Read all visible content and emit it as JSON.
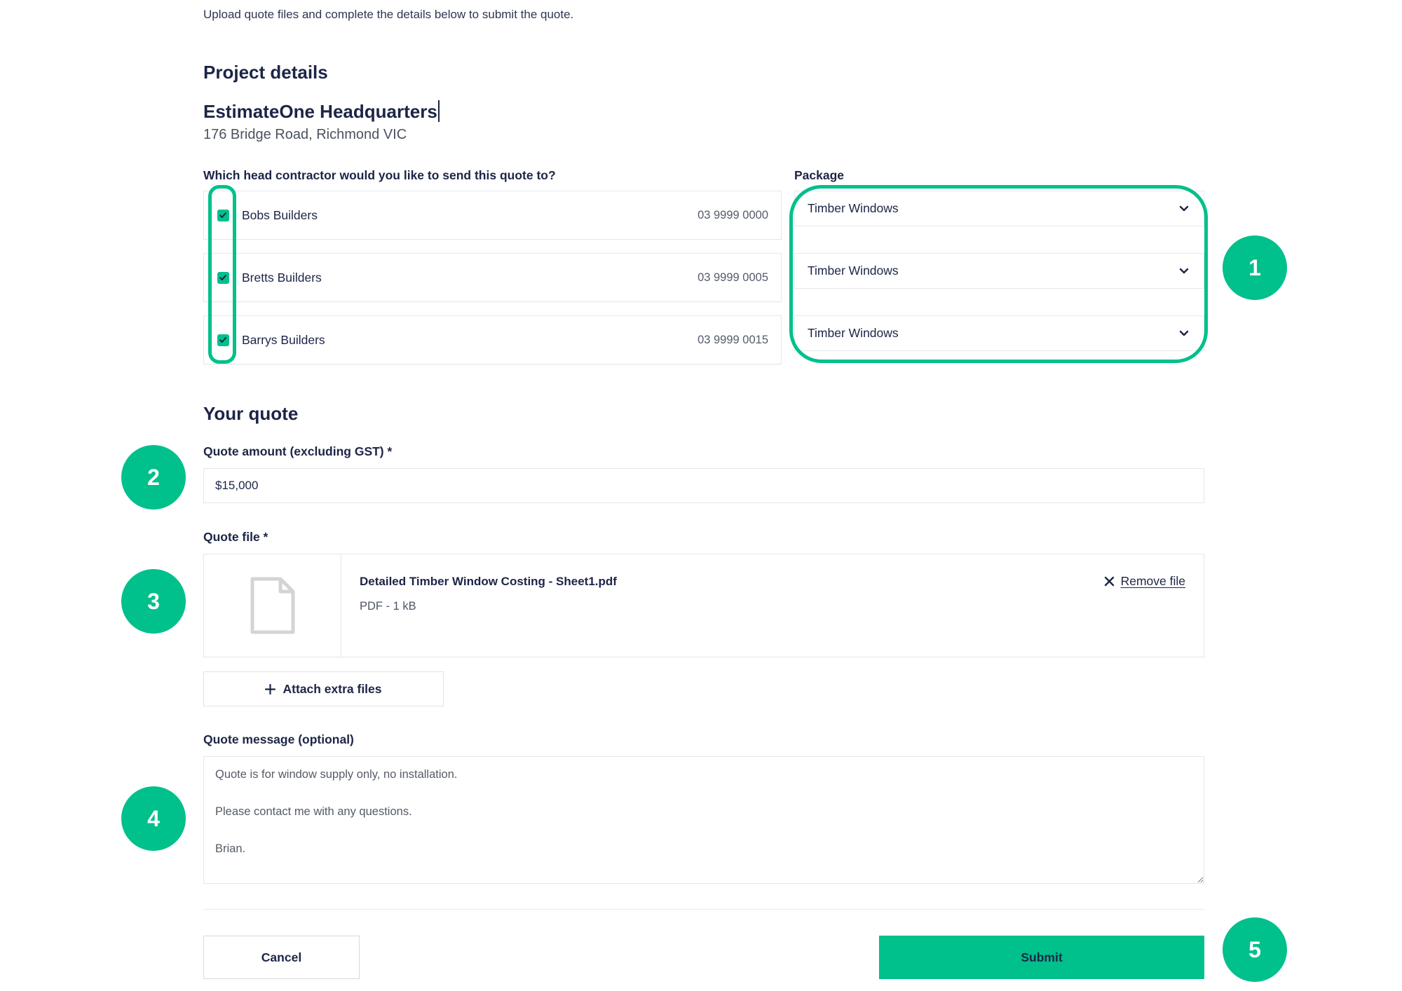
{
  "intro": "Upload quote files and complete the details below to submit the quote.",
  "project": {
    "heading": "Project details",
    "name": "EstimateOne Headquarters",
    "address": "176 Bridge Road, Richmond VIC"
  },
  "recipients": {
    "question": "Which head contractor would you like to send this quote to?",
    "package_label": "Package",
    "rows": [
      {
        "name": "Bobs Builders",
        "phone": "03 9999 0000",
        "checked": true,
        "package": "Timber Windows"
      },
      {
        "name": "Bretts Builders",
        "phone": "03 9999 0005",
        "checked": true,
        "package": "Timber Windows"
      },
      {
        "name": "Barrys Builders",
        "phone": "03 9999 0015",
        "checked": true,
        "package": "Timber Windows"
      }
    ]
  },
  "quote": {
    "heading": "Your quote",
    "amount": {
      "label": "Quote amount (excluding GST) *",
      "value": "$15,000"
    },
    "file": {
      "label": "Quote file *",
      "name": "Detailed Timber Window Costing - Sheet1.pdf",
      "meta": "PDF - 1 kB",
      "remove_label": "Remove file"
    },
    "attach_label": "Attach extra files",
    "message": {
      "label": "Quote message (optional)",
      "value": "Quote is for window supply only, no installation.\n\nPlease contact me with any questions.\n\nBrian."
    }
  },
  "actions": {
    "cancel": "Cancel",
    "submit": "Submit"
  },
  "callouts": [
    "1",
    "2",
    "3",
    "4",
    "5"
  ],
  "icons": {
    "checkbox": "checkmark-icon",
    "select": "chevron-down-icon",
    "file": "file-icon",
    "remove": "close-icon",
    "attach": "plus-icon"
  },
  "colors": {
    "accent": "#00c08b",
    "text": "#1c2547",
    "border": "#e3e6ea"
  }
}
